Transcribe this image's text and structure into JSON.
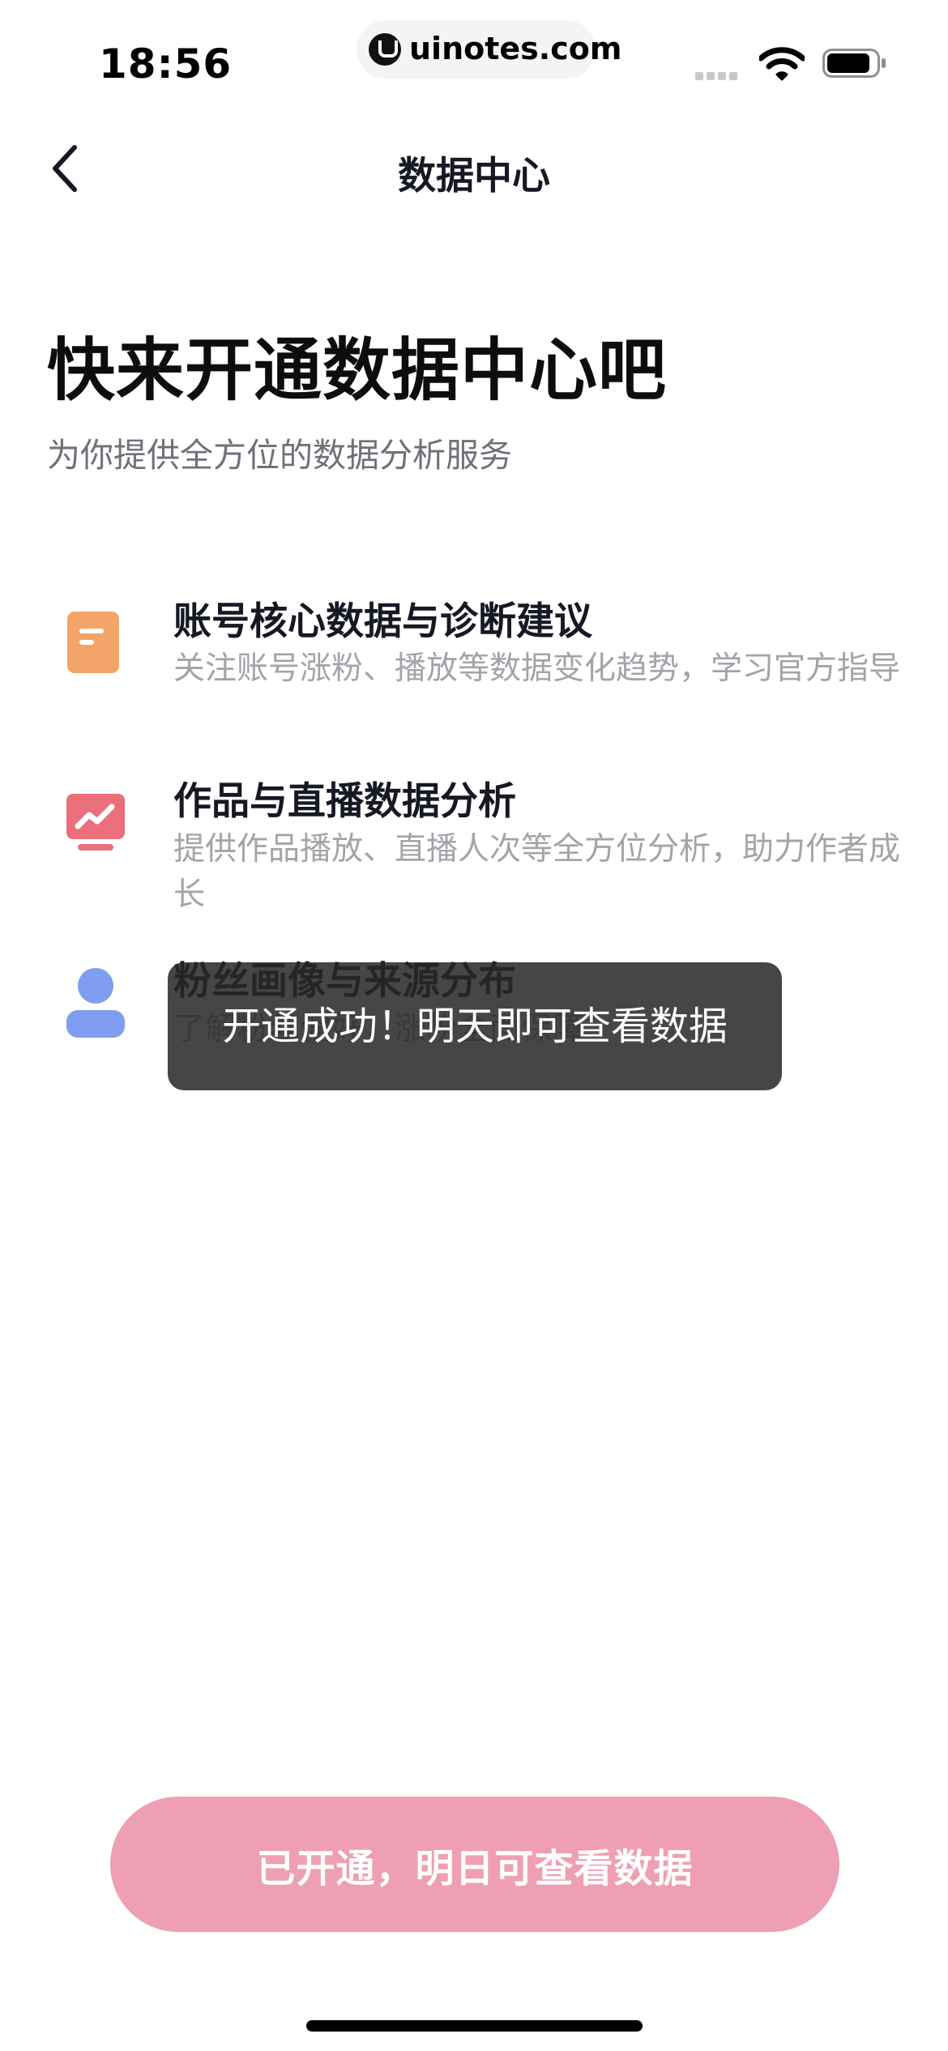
{
  "status_bar": {
    "time": "18:56",
    "url": "uinotes.com"
  },
  "nav": {
    "title": "数据中心"
  },
  "hero": {
    "title": "快来开通数据中心吧",
    "subtitle": "为你提供全方位的数据分析服务"
  },
  "features": [
    {
      "title": "账号核心数据与诊断建议",
      "description": "关注账号涨粉、播放等数据变化趋势，学习官方指导",
      "icon": "document-icon",
      "color": "#f3a469"
    },
    {
      "title": "作品与直播数据分析",
      "description": "提供作品播放、直播人次等全方位分析，助力作者成长",
      "icon": "trend-chart-icon",
      "color": "#ec6f7c"
    },
    {
      "title": "粉丝画像与来源分布",
      "description": "了解粉丝偏好，涨粉全面保障",
      "icon": "user-icon",
      "color": "#7f9ef2"
    }
  ],
  "toast": {
    "message": "开通成功！明天即可查看数据"
  },
  "bottom_button": {
    "label": "已开通，明日可查看数据",
    "color": "#ee9fb3"
  }
}
